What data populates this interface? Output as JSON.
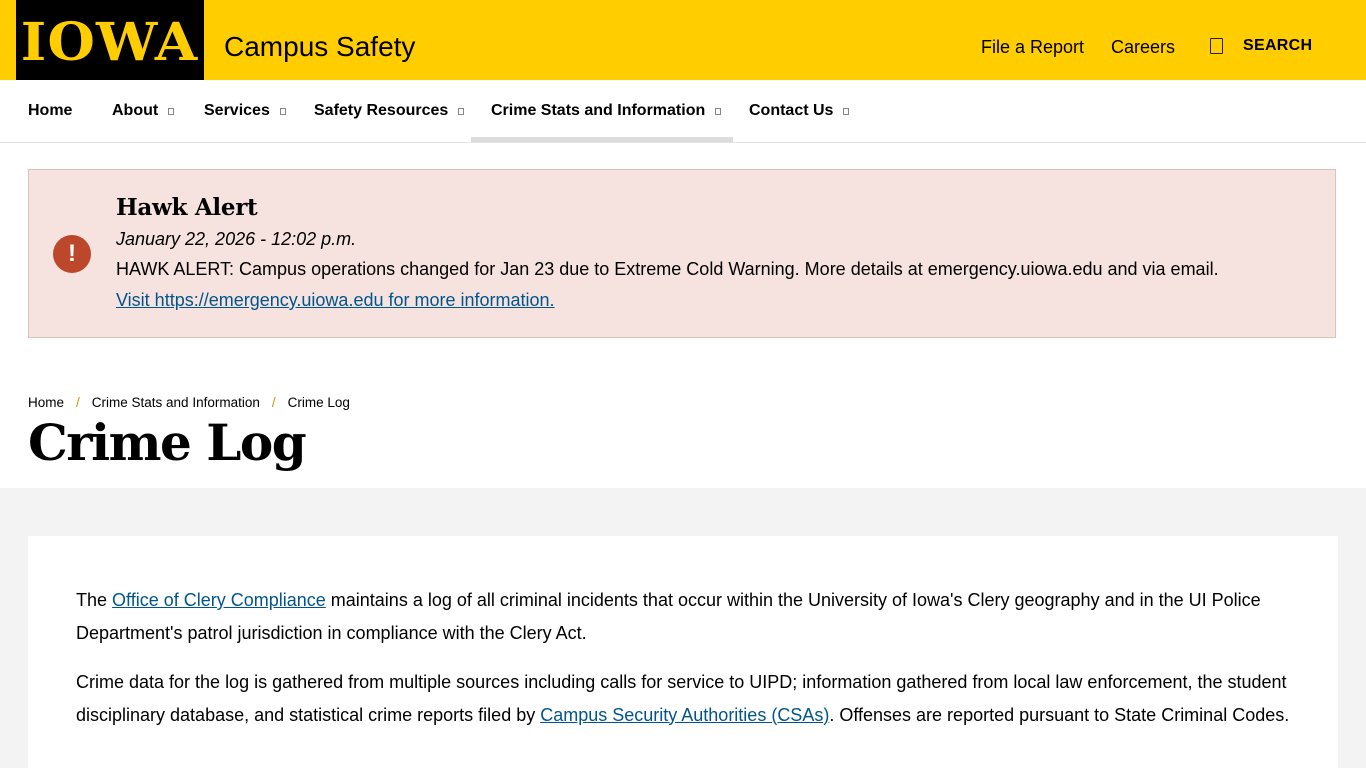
{
  "header": {
    "logo_text": "IOWA",
    "site_title": "Campus Safety",
    "links": {
      "file_report": "File a Report",
      "careers": "Careers"
    },
    "search_label": "SEARCH",
    "brand_color": "#ffcd00"
  },
  "nav": {
    "items": [
      {
        "label": "Home"
      },
      {
        "label": "About"
      },
      {
        "label": "Services"
      },
      {
        "label": "Safety Resources"
      },
      {
        "label": "Crime Stats and Information",
        "active": true
      },
      {
        "label": "Contact Us"
      }
    ]
  },
  "alert": {
    "icon": "!",
    "title": "Hawk Alert",
    "date": "January 22, 2026 - 12:02 p.m.",
    "message": "HAWK ALERT: Campus operations changed for Jan 23 due to Extreme Cold Warning. More details at emergency.uiowa.edu and via email.",
    "link_text": "Visit https://emergency.uiowa.edu for more information.",
    "background": "#f6e2df",
    "icon_color": "#bd472a"
  },
  "breadcrumb": [
    "Home",
    "Crime Stats and Information",
    "Crime Log"
  ],
  "page_title": "Crime Log",
  "content": {
    "p1": {
      "before": "The ",
      "link": "Office of Clery Compliance",
      "after": " maintains a log of all criminal incidents that occur within the University of Iowa's Clery geography and in the UI Police Department's patrol jurisdiction in compliance with the Clery Act."
    },
    "p2": {
      "before": "Crime data for the log is gathered from multiple sources including calls for service to UIPD; information gathered from local law enforcement, the student disciplinary database, and statistical crime reports filed by ",
      "link": "Campus Security Authorities (CSAs)",
      "after": ". Offenses are reported pursuant to State Criminal Codes."
    },
    "link_color": "#00558c"
  }
}
